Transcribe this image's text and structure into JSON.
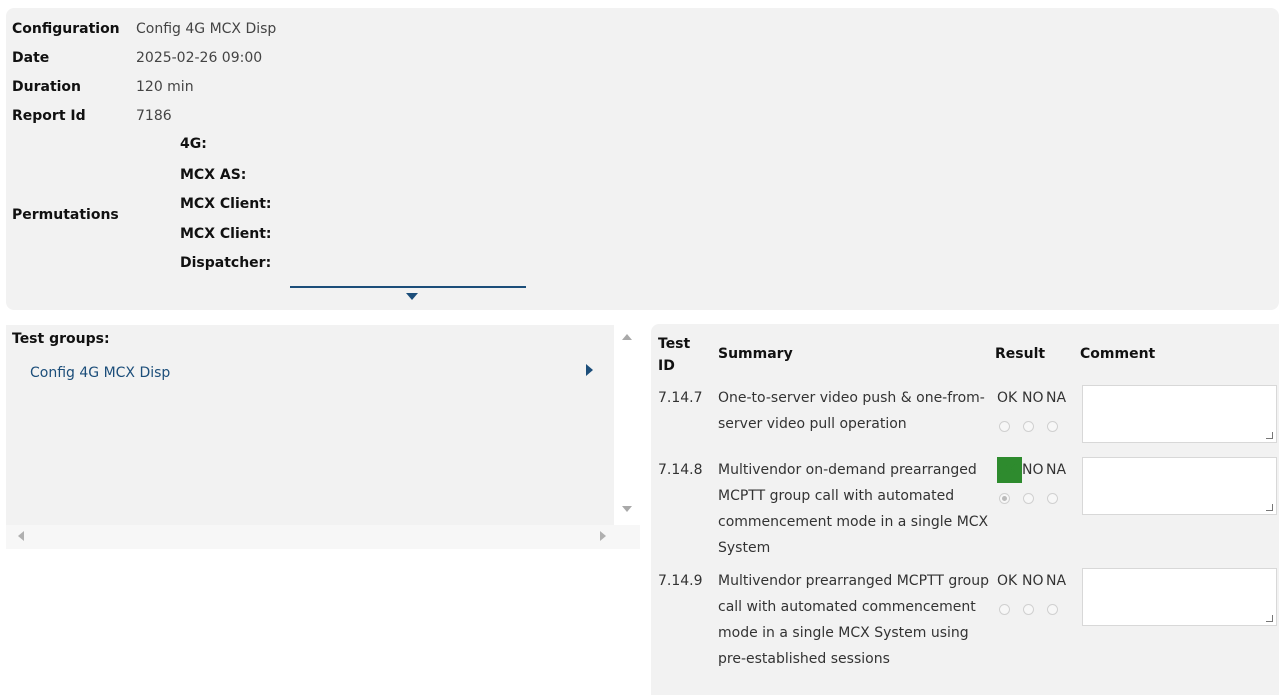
{
  "header": {
    "fields": [
      {
        "label": "Configuration",
        "value": "Config 4G MCX Disp"
      },
      {
        "label": "Date",
        "value": "2025-02-26 09:00"
      },
      {
        "label": "Duration",
        "value": "120 min"
      },
      {
        "label": "Report Id",
        "value": "7186"
      }
    ],
    "permutations_label": "Permutations",
    "permutations": [
      "4G:",
      "MCX AS:",
      "MCX Client:",
      "MCX Client:",
      "Dispatcher:"
    ]
  },
  "groups": {
    "title": "Test groups:",
    "items": [
      "Config 4G MCX Disp"
    ]
  },
  "results": {
    "columns": {
      "id": "Test ID",
      "summary": "Summary",
      "result": "Result",
      "comment": "Comment"
    },
    "options": [
      "OK",
      "NO",
      "NA"
    ],
    "rows": [
      {
        "id": "7.14.7",
        "summary": "One-to-server video push & one-from-server video pull operation",
        "selected": "",
        "comment": ""
      },
      {
        "id": "7.14.8",
        "summary": "Multivendor on-demand prearranged MCPTT group call with automated commencement mode in a single MCX System",
        "selected": "OK",
        "comment": ""
      },
      {
        "id": "7.14.9",
        "summary": "Multivendor prearranged MCPTT group call with automated commencement mode in a single MCX System using pre-established sessions",
        "selected": "",
        "comment": ""
      }
    ],
    "selected_color": "#2e8b2e"
  }
}
